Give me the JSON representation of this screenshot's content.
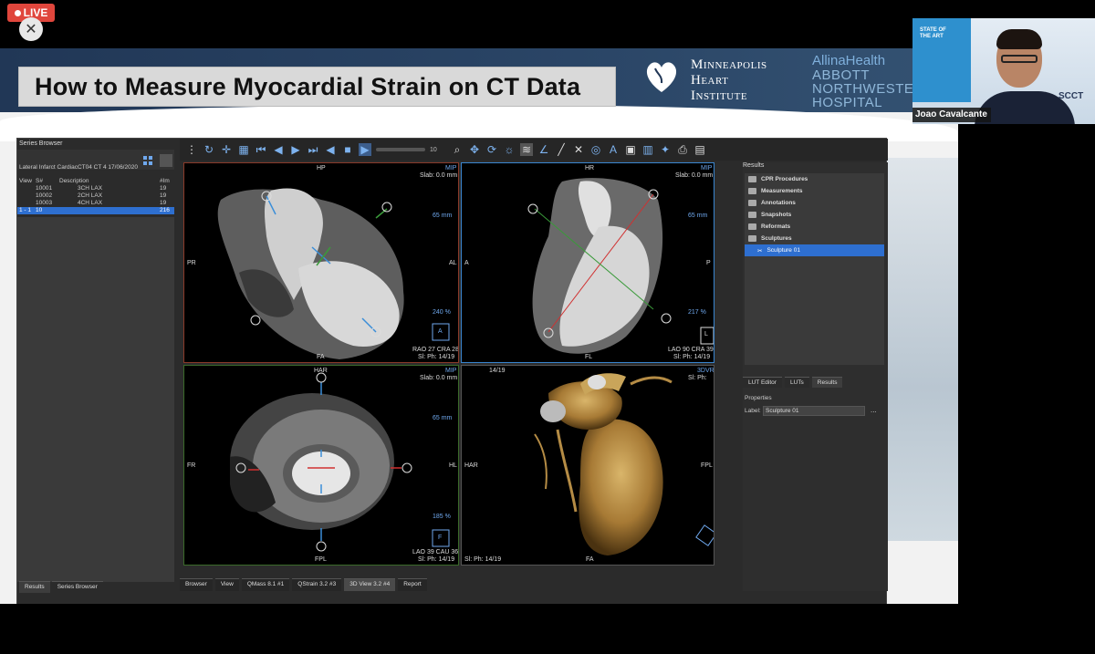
{
  "live_badge": {
    "label": "LIVE"
  },
  "close_button": {
    "label": "✕"
  },
  "slide": {
    "title": "How to Measure Myocardial Strain on CT Data",
    "logo_mhi": [
      "Minneapolis",
      "Heart",
      "Institute"
    ],
    "logo_allina": "AllinaHealth",
    "logo_abbott": [
      "ABBOTT",
      "NORTHWESTE",
      "HOSPITAL"
    ]
  },
  "series_browser": {
    "title": "Series Browser",
    "path": "Lateral Infarct CardiacCT04 CT 4 17/06/2020",
    "columns": [
      "View",
      "S#",
      "Description",
      "#Im"
    ],
    "rows": [
      [
        "",
        "10001",
        "3CH LAX",
        "19"
      ],
      [
        "",
        "10002",
        "2CH LAX",
        "19"
      ],
      [
        "",
        "10003",
        "4CH LAX",
        "19"
      ],
      [
        "1 - 1",
        "10",
        "",
        "216"
      ]
    ],
    "tabs": [
      "Results",
      "Series Browser"
    ]
  },
  "toolbar": {
    "frame_value": "10"
  },
  "viewports": {
    "vp1": {
      "top": "HP",
      "left": "PR",
      "right": "AL",
      "bottom": "FA",
      "mode": "MIP",
      "slab": "Slab: 0.0 mm",
      "scale": "65 mm",
      "zoom": "240 %",
      "angle": "RAO 27 CRA 28",
      "slice": "Sl: Ph: 14/19",
      "cube": "A"
    },
    "vp2": {
      "top": "HR",
      "left": "A",
      "right": "P",
      "bottom": "FL",
      "mode": "MIP",
      "slab": "Slab: 0.0 mm",
      "scale": "65 mm",
      "zoom": "217 %",
      "angle": "LAO 90 CRA 39",
      "slice": "Sl: Ph: 14/19",
      "cube": "L"
    },
    "vp3": {
      "top": "HAR",
      "left": "FR",
      "right": "HL",
      "bottom": "FPL",
      "mode": "MIP",
      "slab": "Slab: 0.0 mm",
      "scale": "65 mm",
      "zoom": "185 %",
      "angle": "LAO 39 CAU 36",
      "slice": "Sl: Ph: 14/19",
      "cube": "F"
    },
    "vp4": {
      "topleft": "14/19",
      "left": "HAR",
      "right": "FPL",
      "bottom": "FA",
      "mode": "3DVR",
      "slice": "Sl: Ph: 14/19",
      "sl_right": "Sl: Ph:"
    }
  },
  "results_panel": {
    "title": "Results",
    "items": [
      "CPR Procedures",
      "Measurements",
      "Annotations",
      "Snapshots",
      "Reformats",
      "Sculptures"
    ],
    "selected_item": "Sculpture 01",
    "tabs": [
      "LUT Editor",
      "LUTs",
      "Results"
    ],
    "properties_label": "Properties",
    "label_field_label": "Label:",
    "label_field_value": "Sculpture 01",
    "more": "..."
  },
  "bottom_tabs": [
    "Browser",
    "View",
    "QMass 8.1 #1",
    "QStrain 3.2 #3",
    "3D View 3.2 #4",
    "Report"
  ],
  "webcam": {
    "name": "Joao Cavalcante",
    "sign_text": "STATE OF THE ART",
    "scct": "SCCT"
  },
  "colors": {
    "accent_blue": "#2e6fd0",
    "live_red": "#e0463c",
    "slide_header": "#213756"
  }
}
